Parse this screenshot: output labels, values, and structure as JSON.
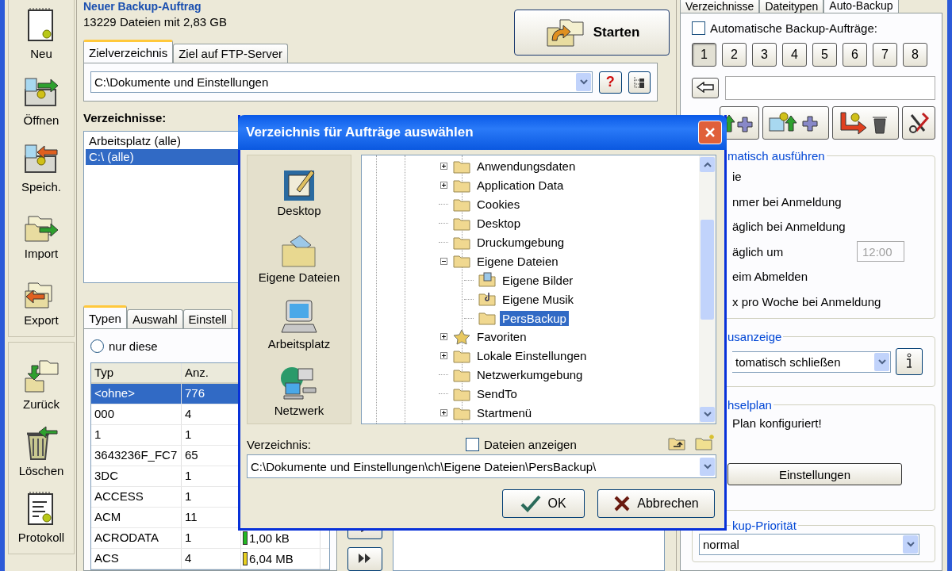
{
  "job": {
    "title": "Neuer Backup-Auftrag",
    "summary": "13229 Dateien mit 2,83 GB",
    "start_button": "Starten"
  },
  "toolbar_groups": [
    [
      {
        "label": "Neu",
        "kind": "new"
      },
      {
        "label": "Öffnen",
        "kind": "open"
      },
      {
        "label": "Speich.",
        "kind": "save"
      },
      {
        "label": "Import",
        "kind": "import"
      },
      {
        "label": "Export",
        "kind": "export"
      }
    ],
    [
      {
        "label": "Zurück",
        "kind": "back"
      },
      {
        "label": "Löschen",
        "kind": "delete"
      },
      {
        "label": "Protokoll",
        "kind": "log"
      }
    ]
  ],
  "target_tabs": [
    {
      "label": "Zielverzeichnis",
      "selected": true
    },
    {
      "label": "Ziel auf FTP-Server",
      "selected": false
    }
  ],
  "target": {
    "path": "C:\\Dokumente und Einstellungen",
    "help_button": "?"
  },
  "directories": {
    "label": "Verzeichnisse:",
    "items": [
      {
        "label": "Arbeitsplatz (alle)",
        "selected": false
      },
      {
        "label": "C:\\ (alle)",
        "selected": true
      }
    ]
  },
  "type_tabs": [
    {
      "label": "Typen",
      "selected": true
    },
    {
      "label": "Auswahl",
      "selected": false
    },
    {
      "label": "Einstell",
      "selected": false
    }
  ],
  "only_these": {
    "label": "nur diese",
    "selected": false
  },
  "types_table": {
    "columns": [
      "Typ",
      "Anz."
    ],
    "rows": [
      {
        "type": "<ohne>",
        "count": "776",
        "selected": true
      },
      {
        "type": "000",
        "count": "4",
        "selected": false
      },
      {
        "type": "1",
        "count": "1",
        "selected": false
      },
      {
        "type": "3643236F_FC7",
        "count": "65",
        "selected": false
      },
      {
        "type": "3DC",
        "count": "1",
        "selected": false
      },
      {
        "type": "ACCESS",
        "count": "1",
        "selected": false
      },
      {
        "type": "ACM",
        "count": "11",
        "selected": false
      },
      {
        "type": "ACRODATA",
        "count": "1",
        "size": "1,00 kB",
        "color": "#22b822",
        "selected": false
      },
      {
        "type": "ACS",
        "count": "4",
        "size": "6,04 MB",
        "color": "#e8d020",
        "selected": false
      }
    ]
  },
  "right_tabs": [
    {
      "label": "Verzeichnisse",
      "selected": false
    },
    {
      "label": "Dateitypen",
      "selected": false
    },
    {
      "label": "Auto-Backup",
      "selected": true
    }
  ],
  "auto_jobs": {
    "label": "Automatische Backup-Aufträge:",
    "checked": false,
    "slots": [
      {
        "label": "1",
        "selected": true
      },
      {
        "label": "2",
        "selected": false
      },
      {
        "label": "3",
        "selected": false
      },
      {
        "label": "4",
        "selected": false
      },
      {
        "label": "5",
        "selected": false
      },
      {
        "label": "6",
        "selected": false
      },
      {
        "label": "7",
        "selected": false
      },
      {
        "label": "8",
        "selected": false
      }
    ]
  },
  "run_group": {
    "title": "matisch ausführen",
    "options": [
      {
        "label": "ie"
      },
      {
        "label": "nmer bei Anmeldung"
      },
      {
        "label": "äglich bei Anmeldung"
      },
      {
        "label": "äglich um",
        "time": "12:00",
        "time_disabled": true
      },
      {
        "label": "eim Abmelden"
      },
      {
        "label": "x pro Woche bei Anmeldung"
      }
    ]
  },
  "status_group": {
    "title": "usanzeige",
    "value": "tomatisch schließen"
  },
  "plan_group": {
    "title": "hselplan",
    "message": "Plan konfiguriert!",
    "button": "Einstellungen"
  },
  "priority_group": {
    "title": "kup-Priorität",
    "value": "normal"
  },
  "dialog": {
    "title": "Verzeichnis für Aufträge auswählen",
    "places": [
      {
        "label": "Desktop",
        "kind": "desktop"
      },
      {
        "label": "Eigene Dateien",
        "kind": "documents"
      },
      {
        "label": "Arbeitsplatz",
        "kind": "computer"
      },
      {
        "label": "Netzwerk",
        "kind": "network"
      }
    ],
    "tree": [
      {
        "label": "Anwendungsdaten",
        "kind": "folder",
        "expanded": false,
        "selected": false
      },
      {
        "label": "Application Data",
        "kind": "folder",
        "expanded": false,
        "selected": false
      },
      {
        "label": "Cookies",
        "kind": "folder",
        "selected": false
      },
      {
        "label": "Desktop",
        "kind": "folder",
        "selected": false
      },
      {
        "label": "Druckumgebung",
        "kind": "folder",
        "selected": false
      },
      {
        "label": "Eigene Dateien",
        "kind": "folder",
        "expanded": true,
        "selected": false,
        "children": [
          {
            "label": "Eigene Bilder",
            "kind": "picture-folder",
            "selected": false
          },
          {
            "label": "Eigene Musik",
            "kind": "music-folder",
            "selected": false
          },
          {
            "label": "PersBackup",
            "kind": "folder",
            "selected": true
          }
        ]
      },
      {
        "label": "Favoriten",
        "kind": "star",
        "expanded": false,
        "selected": false
      },
      {
        "label": "Lokale Einstellungen",
        "kind": "folder",
        "expanded": false,
        "selected": false
      },
      {
        "label": "Netzwerkumgebung",
        "kind": "folder",
        "selected": false
      },
      {
        "label": "SendTo",
        "kind": "folder",
        "selected": false
      },
      {
        "label": "Startmenü",
        "kind": "folder",
        "expanded": false,
        "selected": false
      }
    ],
    "show_files": {
      "label": "Dateien anzeigen",
      "checked": false
    },
    "path_label": "Verzeichnis:",
    "path": "C:\\Dokumente und Einstellungen\\ch\\Eigene Dateien\\PersBackup\\",
    "buttons": [
      {
        "label": "OK",
        "kind": "ok"
      },
      {
        "label": "Abbrechen",
        "kind": "cancel"
      }
    ]
  }
}
